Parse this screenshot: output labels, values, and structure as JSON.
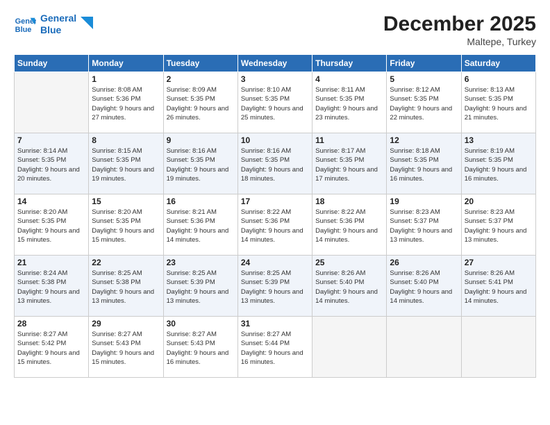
{
  "logo": {
    "line1": "General",
    "line2": "Blue"
  },
  "title": "December 2025",
  "location": "Maltepe, Turkey",
  "days_of_week": [
    "Sunday",
    "Monday",
    "Tuesday",
    "Wednesday",
    "Thursday",
    "Friday",
    "Saturday"
  ],
  "weeks": [
    [
      {
        "day": "",
        "empty": true
      },
      {
        "day": "1",
        "sunrise": "8:08 AM",
        "sunset": "5:36 PM",
        "daylight": "9 hours and 27 minutes."
      },
      {
        "day": "2",
        "sunrise": "8:09 AM",
        "sunset": "5:35 PM",
        "daylight": "9 hours and 26 minutes."
      },
      {
        "day": "3",
        "sunrise": "8:10 AM",
        "sunset": "5:35 PM",
        "daylight": "9 hours and 25 minutes."
      },
      {
        "day": "4",
        "sunrise": "8:11 AM",
        "sunset": "5:35 PM",
        "daylight": "9 hours and 23 minutes."
      },
      {
        "day": "5",
        "sunrise": "8:12 AM",
        "sunset": "5:35 PM",
        "daylight": "9 hours and 22 minutes."
      },
      {
        "day": "6",
        "sunrise": "8:13 AM",
        "sunset": "5:35 PM",
        "daylight": "9 hours and 21 minutes."
      }
    ],
    [
      {
        "day": "7",
        "sunrise": "8:14 AM",
        "sunset": "5:35 PM",
        "daylight": "9 hours and 20 minutes."
      },
      {
        "day": "8",
        "sunrise": "8:15 AM",
        "sunset": "5:35 PM",
        "daylight": "9 hours and 19 minutes."
      },
      {
        "day": "9",
        "sunrise": "8:16 AM",
        "sunset": "5:35 PM",
        "daylight": "9 hours and 19 minutes."
      },
      {
        "day": "10",
        "sunrise": "8:16 AM",
        "sunset": "5:35 PM",
        "daylight": "9 hours and 18 minutes."
      },
      {
        "day": "11",
        "sunrise": "8:17 AM",
        "sunset": "5:35 PM",
        "daylight": "9 hours and 17 minutes."
      },
      {
        "day": "12",
        "sunrise": "8:18 AM",
        "sunset": "5:35 PM",
        "daylight": "9 hours and 16 minutes."
      },
      {
        "day": "13",
        "sunrise": "8:19 AM",
        "sunset": "5:35 PM",
        "daylight": "9 hours and 16 minutes."
      }
    ],
    [
      {
        "day": "14",
        "sunrise": "8:20 AM",
        "sunset": "5:35 PM",
        "daylight": "9 hours and 15 minutes."
      },
      {
        "day": "15",
        "sunrise": "8:20 AM",
        "sunset": "5:35 PM",
        "daylight": "9 hours and 15 minutes."
      },
      {
        "day": "16",
        "sunrise": "8:21 AM",
        "sunset": "5:36 PM",
        "daylight": "9 hours and 14 minutes."
      },
      {
        "day": "17",
        "sunrise": "8:22 AM",
        "sunset": "5:36 PM",
        "daylight": "9 hours and 14 minutes."
      },
      {
        "day": "18",
        "sunrise": "8:22 AM",
        "sunset": "5:36 PM",
        "daylight": "9 hours and 14 minutes."
      },
      {
        "day": "19",
        "sunrise": "8:23 AM",
        "sunset": "5:37 PM",
        "daylight": "9 hours and 13 minutes."
      },
      {
        "day": "20",
        "sunrise": "8:23 AM",
        "sunset": "5:37 PM",
        "daylight": "9 hours and 13 minutes."
      }
    ],
    [
      {
        "day": "21",
        "sunrise": "8:24 AM",
        "sunset": "5:38 PM",
        "daylight": "9 hours and 13 minutes."
      },
      {
        "day": "22",
        "sunrise": "8:25 AM",
        "sunset": "5:38 PM",
        "daylight": "9 hours and 13 minutes."
      },
      {
        "day": "23",
        "sunrise": "8:25 AM",
        "sunset": "5:39 PM",
        "daylight": "9 hours and 13 minutes."
      },
      {
        "day": "24",
        "sunrise": "8:25 AM",
        "sunset": "5:39 PM",
        "daylight": "9 hours and 13 minutes."
      },
      {
        "day": "25",
        "sunrise": "8:26 AM",
        "sunset": "5:40 PM",
        "daylight": "9 hours and 14 minutes."
      },
      {
        "day": "26",
        "sunrise": "8:26 AM",
        "sunset": "5:40 PM",
        "daylight": "9 hours and 14 minutes."
      },
      {
        "day": "27",
        "sunrise": "8:26 AM",
        "sunset": "5:41 PM",
        "daylight": "9 hours and 14 minutes."
      }
    ],
    [
      {
        "day": "28",
        "sunrise": "8:27 AM",
        "sunset": "5:42 PM",
        "daylight": "9 hours and 15 minutes."
      },
      {
        "day": "29",
        "sunrise": "8:27 AM",
        "sunset": "5:43 PM",
        "daylight": "9 hours and 15 minutes."
      },
      {
        "day": "30",
        "sunrise": "8:27 AM",
        "sunset": "5:43 PM",
        "daylight": "9 hours and 16 minutes."
      },
      {
        "day": "31",
        "sunrise": "8:27 AM",
        "sunset": "5:44 PM",
        "daylight": "9 hours and 16 minutes."
      },
      {
        "day": "",
        "empty": true
      },
      {
        "day": "",
        "empty": true
      },
      {
        "day": "",
        "empty": true
      }
    ]
  ]
}
